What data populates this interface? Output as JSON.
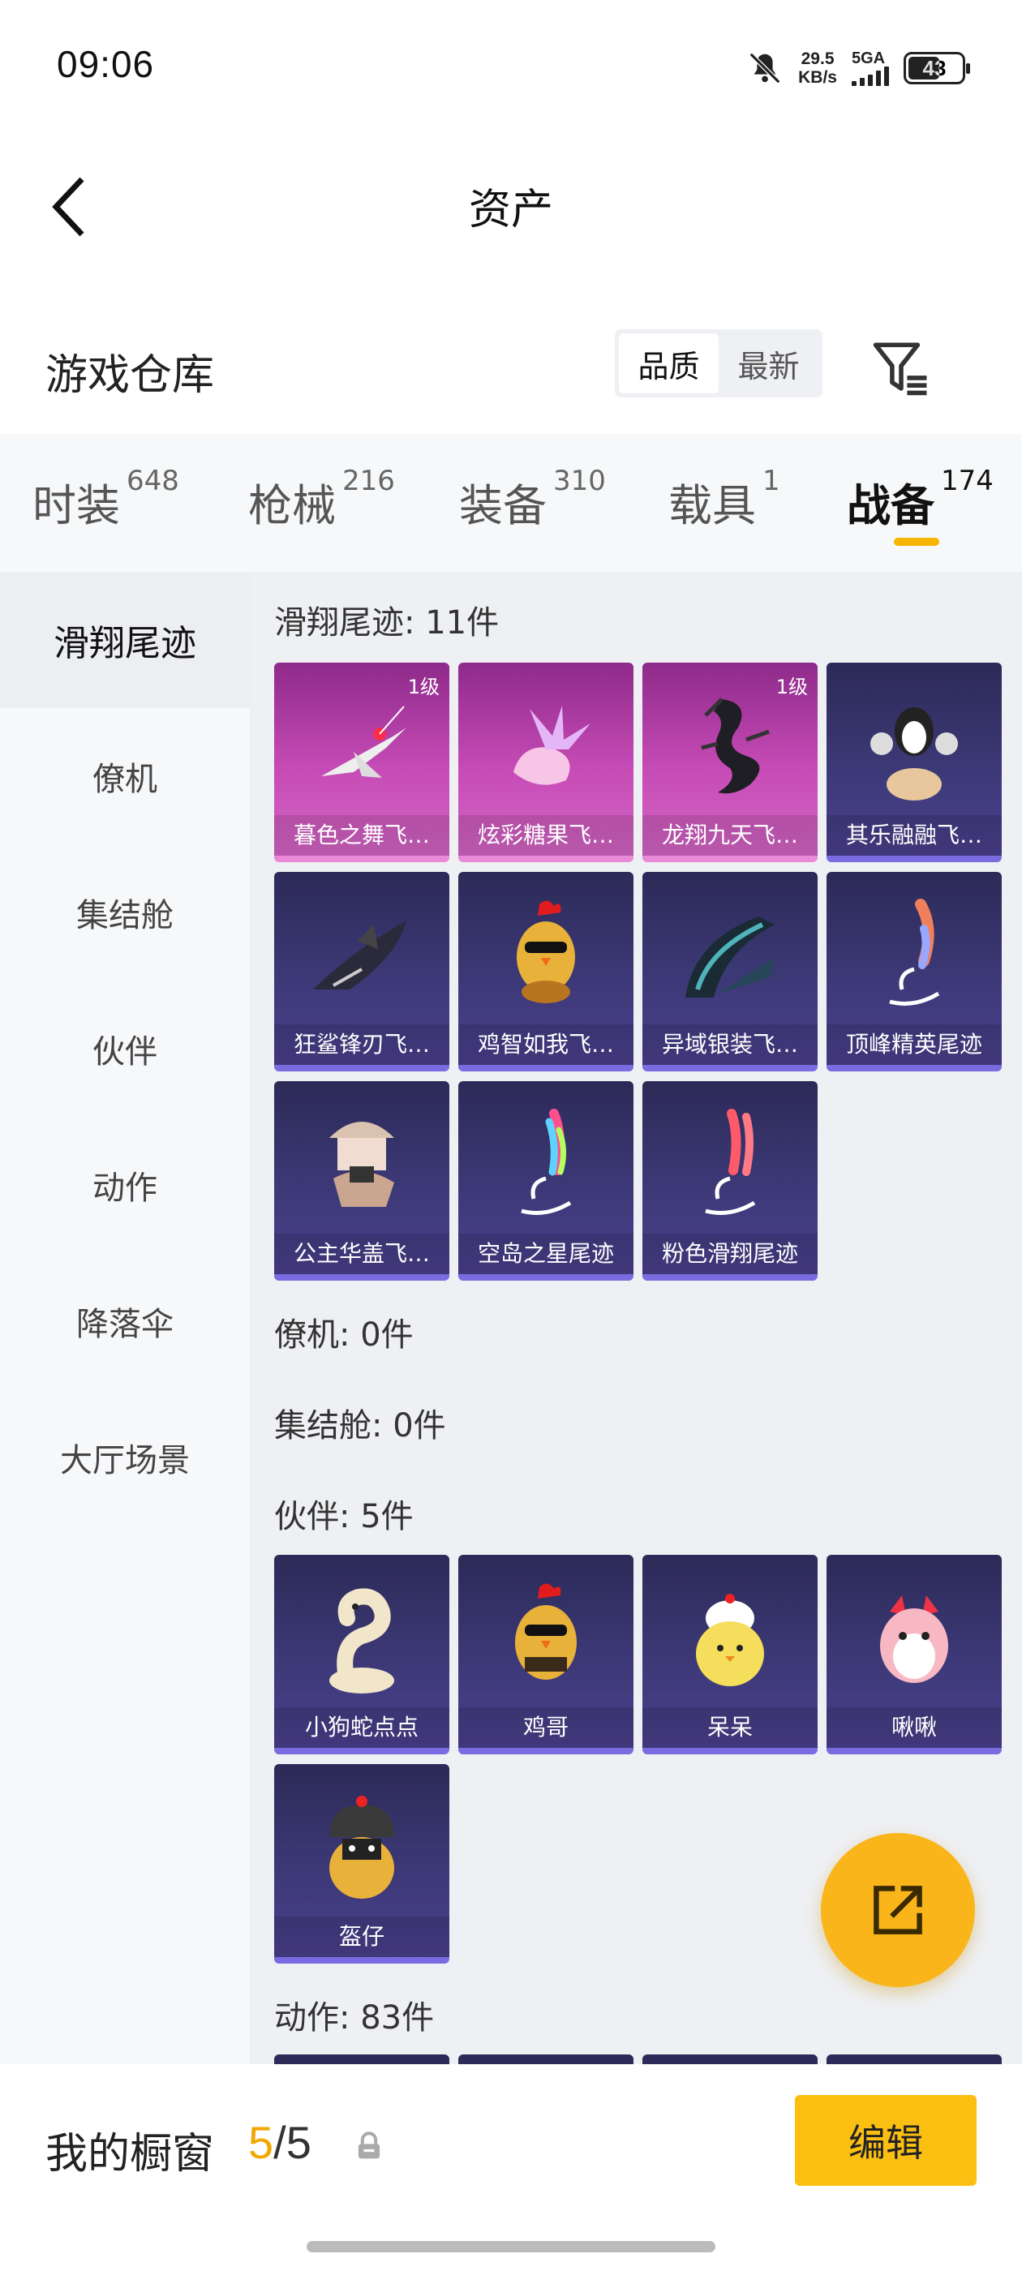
{
  "status": {
    "time": "09:06",
    "speed_value": "29.5",
    "speed_unit": "KB/s",
    "network": "5GA",
    "battery": "43"
  },
  "nav": {
    "title": "资产"
  },
  "section": {
    "title": "游戏仓库",
    "sort": [
      "品质",
      "最新"
    ]
  },
  "tabs": [
    {
      "label": "时装",
      "count": "648"
    },
    {
      "label": "枪械",
      "count": "216"
    },
    {
      "label": "装备",
      "count": "310"
    },
    {
      "label": "载具",
      "count": "1"
    },
    {
      "label": "战备",
      "count": "174"
    }
  ],
  "sidebar": [
    "滑翔尾迹",
    "僚机",
    "集结舱",
    "伙伴",
    "动作",
    "降落伞",
    "大厅场景"
  ],
  "categories": {
    "glide": {
      "title": "滑翔尾迹: 11件"
    },
    "wingman": {
      "title": "僚机: 0件"
    },
    "capsule": {
      "title": "集结舱: 0件"
    },
    "partner": {
      "title": "伙伴: 5件"
    },
    "emote": {
      "title": "动作: 83件"
    }
  },
  "glide_items": [
    {
      "name": "暮色之舞飞…",
      "level": "1级",
      "rarity": "pink",
      "icon": "jet-icon"
    },
    {
      "name": "炫彩糖果飞…",
      "level": "",
      "rarity": "pink",
      "icon": "candy-icon"
    },
    {
      "name": "龙翔九天飞…",
      "level": "1级",
      "rarity": "pink",
      "icon": "dragon-icon"
    },
    {
      "name": "其乐融融飞…",
      "level": "",
      "rarity": "purple",
      "icon": "penguin-icon"
    },
    {
      "name": "狂鲨锋刃飞…",
      "level": "",
      "rarity": "purple",
      "icon": "shark-icon"
    },
    {
      "name": "鸡智如我飞…",
      "level": "",
      "rarity": "purple",
      "icon": "chicken-icon"
    },
    {
      "name": "异域银装飞…",
      "level": "",
      "rarity": "purple",
      "icon": "wing-icon"
    },
    {
      "name": "顶峰精英尾迹",
      "level": "",
      "rarity": "purple",
      "icon": "trail-icon"
    },
    {
      "name": "公主华盖飞…",
      "level": "",
      "rarity": "purple",
      "icon": "carriage-icon"
    },
    {
      "name": "空岛之星尾迹",
      "level": "",
      "rarity": "purple",
      "icon": "rainbow-trail-icon"
    },
    {
      "name": "粉色滑翔尾迹",
      "level": "",
      "rarity": "purple",
      "icon": "pink-trail-icon"
    }
  ],
  "partner_items": [
    {
      "name": "小狗蛇点点",
      "rarity": "purple",
      "icon": "snake-icon"
    },
    {
      "name": "鸡哥",
      "rarity": "purple",
      "icon": "rooster-icon"
    },
    {
      "name": "呆呆",
      "rarity": "purple",
      "icon": "chick-icon"
    },
    {
      "name": "啾啾",
      "rarity": "purple",
      "icon": "bird-icon"
    },
    {
      "name": "盔仔",
      "rarity": "purple",
      "icon": "helmet-chick-icon"
    }
  ],
  "bottom": {
    "showcase_label": "我的橱窗",
    "current": "5",
    "total": "/5",
    "edit": "编辑"
  },
  "colors": {
    "accent": "#f5b500",
    "pink_card": "#c64bb6",
    "purple_card": "#3e3a7a"
  }
}
